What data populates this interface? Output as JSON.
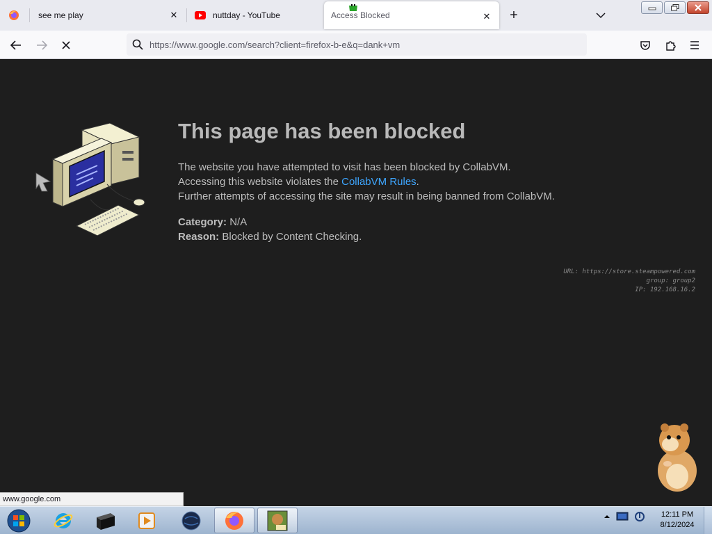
{
  "browser": {
    "tabs": [
      {
        "title": "see me play",
        "icon": "firefox-icon"
      },
      {
        "title": "nuttday - YouTube",
        "icon": "youtube-icon"
      },
      {
        "title": "Access Blocked",
        "icon": "blocked-icon",
        "active": true
      }
    ],
    "url": "https://www.google.com/search?client=firefox-b-e&q=dank+vm",
    "status_url": "www.google.com"
  },
  "page": {
    "headline": "This page has been blocked",
    "line1": "The website you have attempted to visit has been blocked by CollabVM.",
    "line2_prefix": "Accessing this website violates the ",
    "line2_link": "CollabVM Rules",
    "line2_suffix": ".",
    "line3": "Further attempts of accessing the site may result in being banned from CollabVM.",
    "category_label": "Category:",
    "category_value": "N/A",
    "reason_label": "Reason:",
    "reason_value": "Blocked by Content Checking.",
    "debug_url": "URL: https://store.steampowered.com",
    "debug_group": "group: group2",
    "debug_ip": "IP: 192.168.16.2"
  },
  "taskbar": {
    "clock_time": "12:11 PM",
    "clock_date": "8/12/2024",
    "items": [
      "start-orb",
      "internet-explorer",
      "terminal",
      "media-player",
      "globe",
      "firefox",
      "box-game"
    ]
  },
  "colors": {
    "page_bg": "#1e1e1e",
    "headline": "#b9b9b9",
    "body_text": "#bdbdbd",
    "link": "#3ea6ff",
    "tabstrip": "#e9eaf0",
    "taskbar": "#b3c6dc"
  }
}
